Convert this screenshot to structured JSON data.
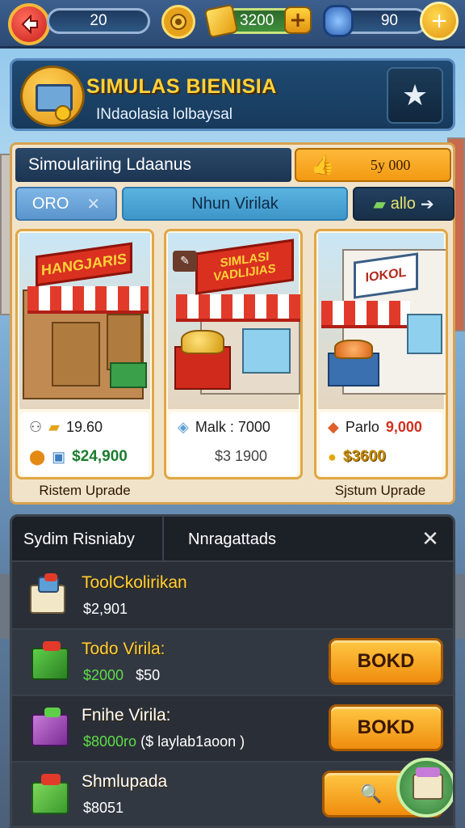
{
  "topbar": {
    "level": "20",
    "gold": "3200",
    "gems": "90"
  },
  "header": {
    "title": "SIMULAS BIENISIA",
    "subtitle": "INdaolasia lolbaysal"
  },
  "shop": {
    "title": "Simoulariing Ldaanus",
    "price_label": "5y 000",
    "tabs": {
      "oro": "ORO",
      "nhun": "Nhun Virilak",
      "allo": "allo"
    },
    "stores": [
      {
        "sign": "HANGJARIS",
        "row1": "19.60",
        "row2": "$24,900",
        "upgrade": "Ristem Uprade"
      },
      {
        "sign": "SIMLASI VADLIJIAS",
        "row1": "Malk : 7000",
        "row2": "$3 1900",
        "upgrade": ""
      },
      {
        "sign": "IOKOL",
        "row1_label": "Parlo",
        "row1_value": "9,000",
        "row2": "$3600",
        "upgrade": "Sjstum Uprade"
      }
    ]
  },
  "list": {
    "tabs": [
      "Sydim Risniaby",
      "Nnragattads"
    ],
    "rows": [
      {
        "name": "ToolCkolirikan",
        "sub": "$2,901",
        "button": ""
      },
      {
        "name": "Todo Virila:",
        "price": "$2000",
        "sub2": "$50",
        "button": "BOKD"
      },
      {
        "name": "Fnihe Virila:",
        "price": "$8000ro",
        "sub2": "($ laylab1aoon )",
        "button": "BOKD"
      },
      {
        "name": "Shmlupada",
        "sub": "$8051",
        "button": ""
      }
    ]
  },
  "colors": {
    "accent_gold": "#ffd23a",
    "accent_orange": "#f29a12",
    "panel_dark": "#2a2f37",
    "header_blue": "#1f4a73"
  }
}
